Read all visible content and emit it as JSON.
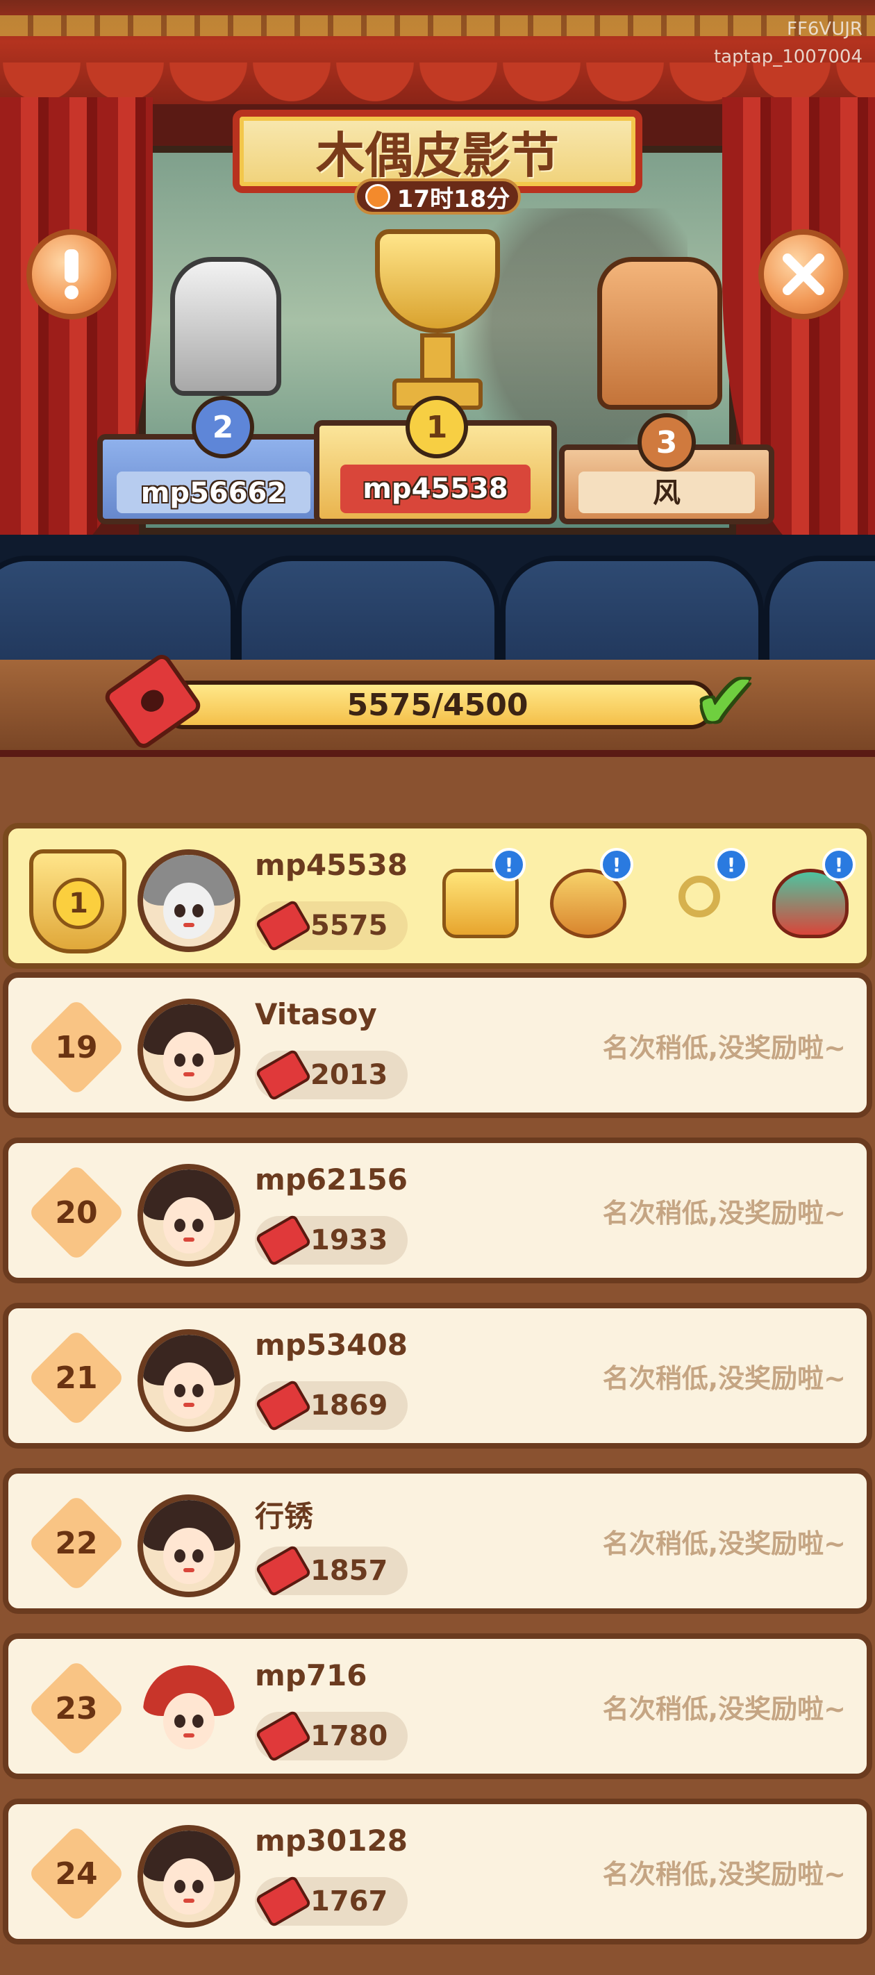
{
  "watermark": {
    "line1": "FF6VUJR",
    "line2": "taptap_1007004"
  },
  "event": {
    "title": "木偶皮影节",
    "timer": "17时18分"
  },
  "podium": [
    {
      "rank": "2",
      "name": "mp56662"
    },
    {
      "rank": "1",
      "name": "mp45538"
    },
    {
      "rank": "3",
      "name": "风"
    }
  ],
  "progress": {
    "text": "5575/4500",
    "fraction": 1.0,
    "complete": true
  },
  "side_buttons": {
    "info_icon": "exclamation-icon",
    "close_icon": "close-icon"
  },
  "leaderboard": [
    {
      "rank": "1",
      "name": "mp45538",
      "score": "5575",
      "self": true,
      "rewards": [
        "gold-nuggets-icon",
        "treasure-pot-icon",
        "key-icon",
        "lucky-bag-icon"
      ]
    },
    {
      "rank": "19",
      "name": "Vitasoy",
      "score": "2013",
      "note": "名次稍低,没奖励啦~"
    },
    {
      "rank": "20",
      "name": "mp62156",
      "score": "1933",
      "note": "名次稍低,没奖励啦~"
    },
    {
      "rank": "21",
      "name": "mp53408",
      "score": "1869",
      "note": "名次稍低,没奖励啦~"
    },
    {
      "rank": "22",
      "name": "行锈",
      "score": "1857",
      "note": "名次稍低,没奖励啦~"
    },
    {
      "rank": "23",
      "name": "mp716",
      "score": "1780",
      "note": "名次稍低,没奖励啦~"
    },
    {
      "rank": "24",
      "name": "mp30128",
      "score": "1767",
      "note": "名次稍低,没奖励啦~"
    }
  ],
  "reward_alert": "!",
  "colors": {
    "accent": "#f4c04a",
    "curtain": "#c8352a",
    "no_reward_text": "#c5a583"
  }
}
